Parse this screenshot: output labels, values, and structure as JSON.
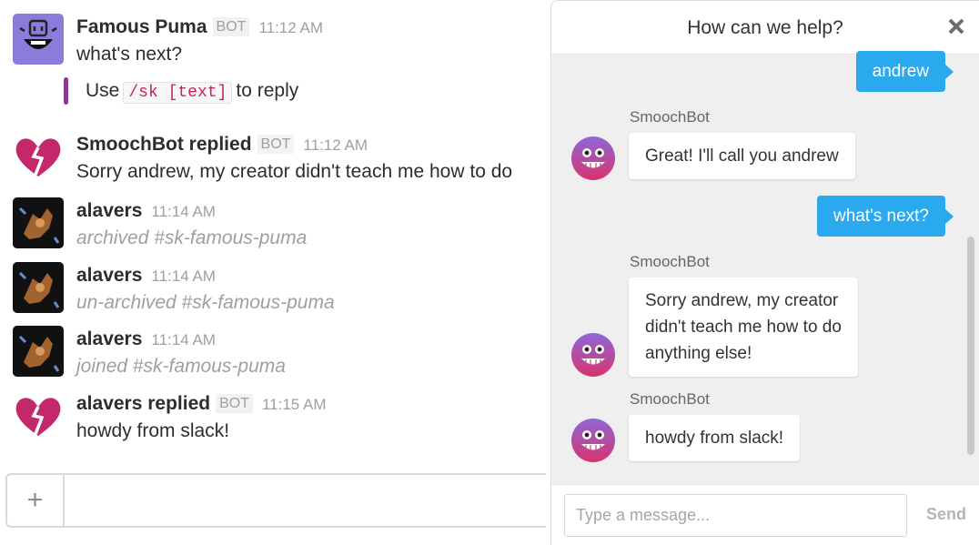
{
  "slack": {
    "messages": [
      {
        "author": "Famous Puma",
        "badge": "BOT",
        "time": "11:12 AM",
        "text": "what's next?",
        "attachment": {
          "prefix": "Use",
          "code": "/sk [text]",
          "suffix": "to reply"
        }
      },
      {
        "author": "SmoochBot replied",
        "badge": "BOT",
        "time": "11:12 AM",
        "text": "Sorry andrew, my creator didn't teach me how to do"
      },
      {
        "author": "alavers",
        "time": "11:14 AM",
        "text": "archived #sk-famous-puma"
      },
      {
        "author": "alavers",
        "time": "11:14 AM",
        "text": "un-archived #sk-famous-puma"
      },
      {
        "author": "alavers",
        "time": "11:14 AM",
        "text": "joined #sk-famous-puma"
      },
      {
        "author": "alavers replied",
        "badge": "BOT",
        "time": "11:15 AM",
        "text": "howdy from slack!"
      }
    ],
    "composer": {
      "plus": "+",
      "value": ""
    }
  },
  "widget": {
    "title": "How can we help?",
    "close_icon": "close-icon",
    "conversation": [
      {
        "from": "user",
        "text": "andrew"
      },
      {
        "from": "bot",
        "sender": "SmoochBot",
        "lines": [
          "Great! I'll call you andrew"
        ]
      },
      {
        "from": "user",
        "text": "what's next?"
      },
      {
        "from": "bot",
        "sender": "SmoochBot",
        "lines": [
          "Sorry andrew, my creator",
          "didn't teach me how to do",
          "anything else!"
        ]
      },
      {
        "from": "bot",
        "sender": "SmoochBot",
        "lines": [
          "howdy from slack!"
        ]
      }
    ],
    "input_placeholder": "Type a message...",
    "send_label": "Send"
  },
  "colors": {
    "user_bubble": "#2aa9ee",
    "attachment_bar": "#8e3a94",
    "puma_avatar": "#8b7cd9",
    "heart_avatar": "#c2286a"
  }
}
